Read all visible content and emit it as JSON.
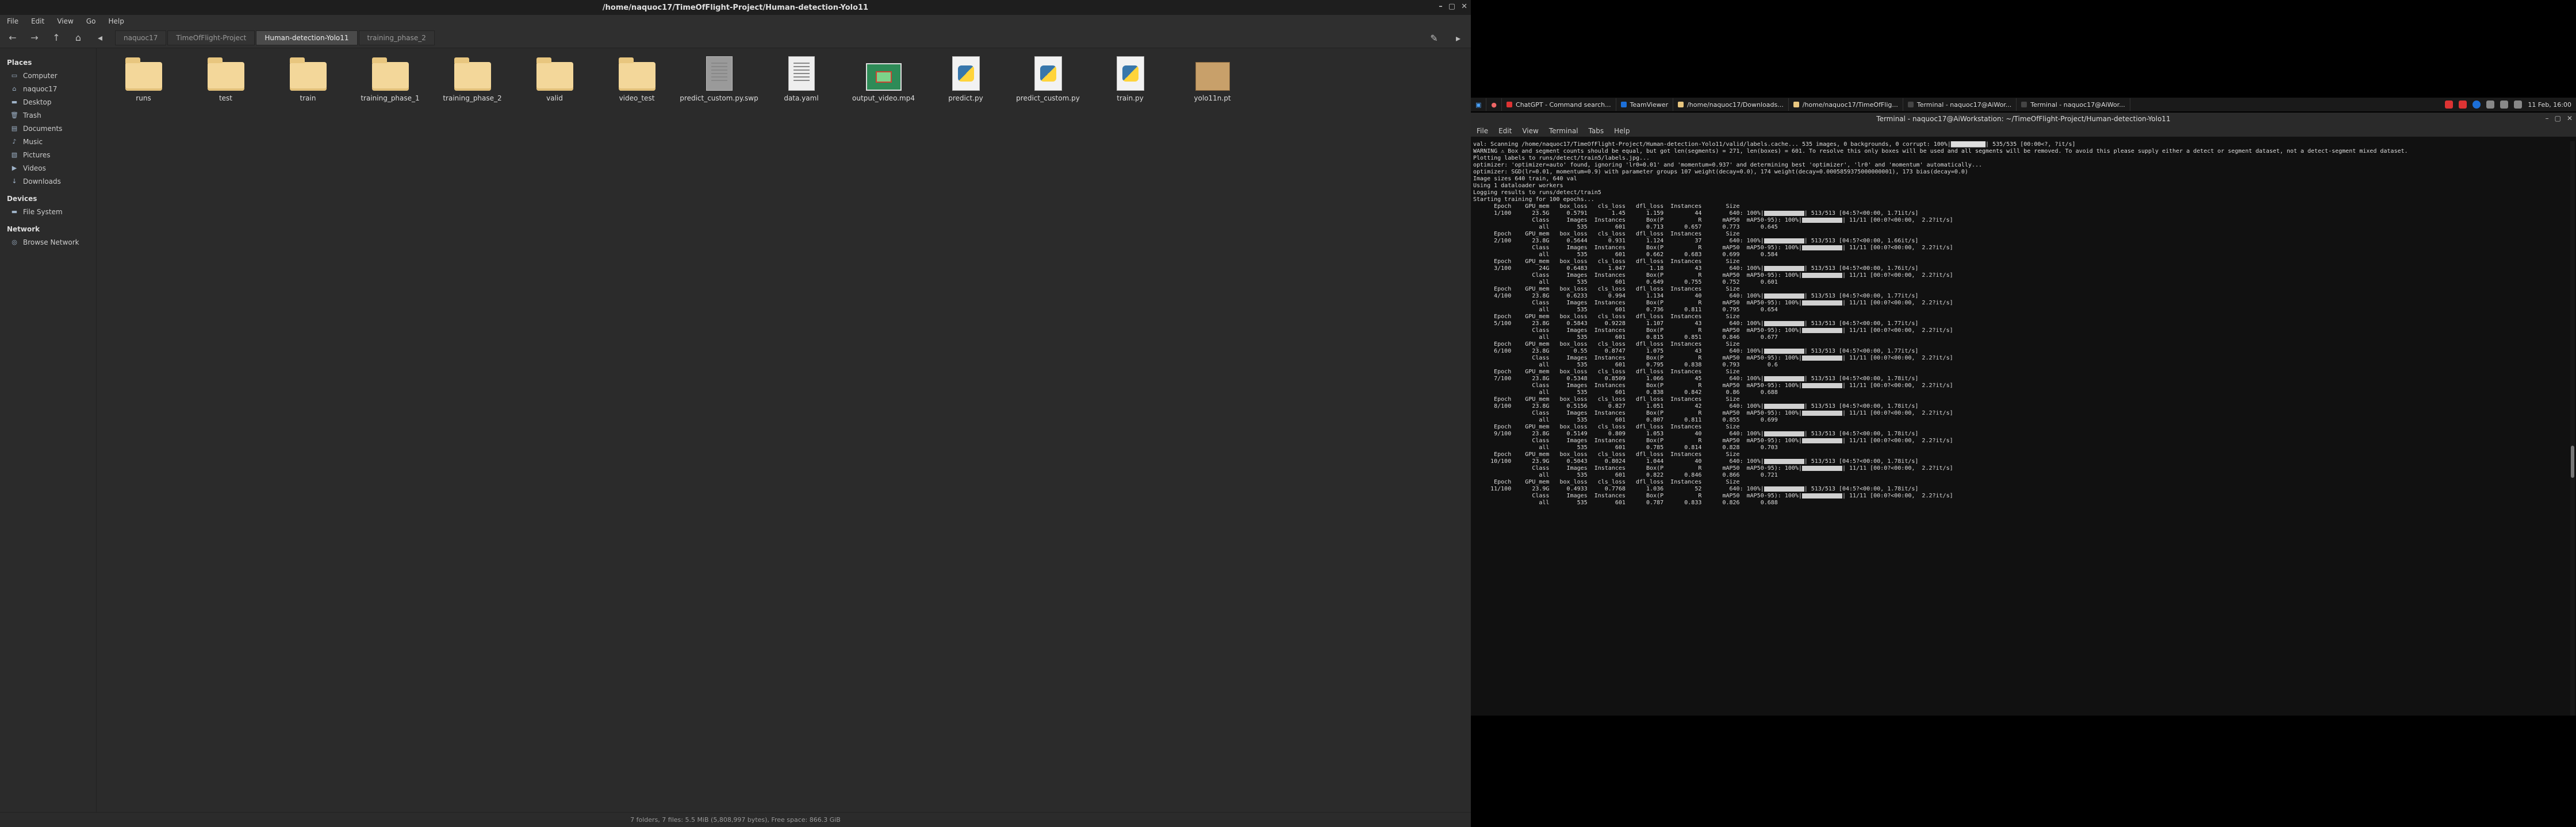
{
  "file_manager": {
    "title": "/home/naquoc17/TimeOfFlight-Project/Human-detection-Yolo11",
    "menu": [
      "File",
      "Edit",
      "View",
      "Go",
      "Help"
    ],
    "breadcrumbs": [
      "naquoc17",
      "TimeOfFlight-Project",
      "Human-detection-Yolo11",
      "training_phase_2"
    ],
    "active_crumb_index": 2,
    "sidebar": {
      "places_header": "Places",
      "places": [
        {
          "label": "Computer",
          "icon": "computer-icon"
        },
        {
          "label": "naquoc17",
          "icon": "home-icon"
        },
        {
          "label": "Desktop",
          "icon": "desktop-icon"
        },
        {
          "label": "Trash",
          "icon": "trash-icon"
        },
        {
          "label": "Documents",
          "icon": "documents-icon"
        },
        {
          "label": "Music",
          "icon": "music-icon"
        },
        {
          "label": "Pictures",
          "icon": "pictures-icon"
        },
        {
          "label": "Videos",
          "icon": "videos-icon"
        },
        {
          "label": "Downloads",
          "icon": "downloads-icon"
        }
      ],
      "devices_header": "Devices",
      "devices": [
        {
          "label": "File System",
          "icon": "drive-icon"
        }
      ],
      "network_header": "Network",
      "network": [
        {
          "label": "Browse Network",
          "icon": "network-icon"
        }
      ]
    },
    "files": [
      {
        "name": "runs",
        "kind": "folder"
      },
      {
        "name": "test",
        "kind": "folder"
      },
      {
        "name": "train",
        "kind": "folder"
      },
      {
        "name": "training_phase_1",
        "kind": "folder"
      },
      {
        "name": "training_phase_2",
        "kind": "folder"
      },
      {
        "name": "valid",
        "kind": "folder"
      },
      {
        "name": "video_test",
        "kind": "folder"
      },
      {
        "name": "predict_custom.py.swp",
        "kind": "swap"
      },
      {
        "name": "data.yaml",
        "kind": "text"
      },
      {
        "name": "output_video.mp4",
        "kind": "video"
      },
      {
        "name": "predict.py",
        "kind": "python"
      },
      {
        "name": "predict_custom.py",
        "kind": "python"
      },
      {
        "name": "train.py",
        "kind": "python"
      },
      {
        "name": "yolo11n.pt",
        "kind": "archive"
      }
    ],
    "status": "7 folders, 7 files: 5.5 MiB (5,808,997 bytes), Free space: 866.3 GiB"
  },
  "taskbar": {
    "buttons": [
      {
        "label": "ChatGPT - Command search...",
        "color": "#d33"
      },
      {
        "label": "TeamViewer",
        "color": "#1c6fd8"
      },
      {
        "label": "/home/naquoc17/Downloads...",
        "color": "#e8c67f"
      },
      {
        "label": "/home/naquoc17/TimeOfFlig...",
        "color": "#e8c67f"
      },
      {
        "label": "Terminal - naquoc17@AiWor...",
        "color": "#444"
      },
      {
        "label": "Terminal - naquoc17@AiWor...",
        "color": "#444"
      }
    ],
    "clock": "11 Feb, 16:00"
  },
  "terminal": {
    "title": "Terminal - naquoc17@AiWorkstation: ~/TimeOfFlight-Project/Human-detection-Yolo11",
    "menu": [
      "File",
      "Edit",
      "View",
      "Terminal",
      "Tabs",
      "Help"
    ],
    "preamble": [
      "val: Scanning /home/naquoc17/TimeOfFlight-Project/Human-detection-Yolo11/valid/labels.cache... 535 images, 0 backgrounds, 0 corrupt: 100%|██████████| 535/535 [00:00<?, ?it/s]",
      "WARNING ⚠ Box and segment counts should be equal, but got len(segments) = 271, len(boxes) = 601. To resolve this only boxes will be used and all segments will be removed. To avoid this please supply either a detect or segment dataset, not a detect-segment mixed dataset.",
      "Plotting labels to runs/detect/train5/labels.jpg...",
      "optimizer: 'optimizer=auto' found, ignoring 'lr0=0.01' and 'momentum=0.937' and determining best 'optimizer', 'lr0' and 'momentum' automatically...",
      "optimizer: SGD(lr=0.01, momentum=0.9) with parameter groups 107 weight(decay=0.0), 174 weight(decay=0.0005859375000000001), 173 bias(decay=0.0)",
      "Image sizes 640 train, 640 val",
      "Using 1 dataloader workers",
      "Logging results to runs/detect/train5",
      "Starting training for 100 epochs..."
    ],
    "epochs": [
      {
        "epoch": "1/100",
        "gpu": "23.5G",
        "box": "0.5791",
        "cls": "1.45",
        "dfl": "1.159",
        "inst": "44",
        "speed": "1.71it/s",
        "P": "0.713",
        "R": "0.657",
        "m50": "0.773",
        "m5095": "0.645"
      },
      {
        "epoch": "2/100",
        "gpu": "23.8G",
        "box": "0.5644",
        "cls": "0.931",
        "dfl": "1.124",
        "inst": "37",
        "speed": "1.66it/s",
        "P": "0.662",
        "R": "0.683",
        "m50": "0.699",
        "m5095": "0.584"
      },
      {
        "epoch": "3/100",
        "gpu": "24G",
        "box": "0.6483",
        "cls": "1.047",
        "dfl": "1.18",
        "inst": "43",
        "speed": "1.76it/s",
        "P": "0.649",
        "R": "0.755",
        "m50": "0.752",
        "m5095": "0.601"
      },
      {
        "epoch": "4/100",
        "gpu": "23.8G",
        "box": "0.6233",
        "cls": "0.994",
        "dfl": "1.134",
        "inst": "40",
        "speed": "1.77it/s",
        "P": "0.736",
        "R": "0.811",
        "m50": "0.795",
        "m5095": "0.654"
      },
      {
        "epoch": "5/100",
        "gpu": "23.8G",
        "box": "0.5843",
        "cls": "0.9228",
        "dfl": "1.107",
        "inst": "43",
        "speed": "1.77it/s",
        "P": "0.815",
        "R": "0.851",
        "m50": "0.846",
        "m5095": "0.677"
      },
      {
        "epoch": "6/100",
        "gpu": "23.8G",
        "box": "0.55",
        "cls": "0.8747",
        "dfl": "1.075",
        "inst": "43",
        "speed": "1.77it/s",
        "P": "0.795",
        "R": "0.838",
        "m50": "0.793",
        "m5095": "0.6"
      },
      {
        "epoch": "7/100",
        "gpu": "23.8G",
        "box": "0.5348",
        "cls": "0.8509",
        "dfl": "1.066",
        "inst": "45",
        "speed": "1.78it/s",
        "P": "0.838",
        "R": "0.842",
        "m50": "0.86",
        "m5095": "0.688"
      },
      {
        "epoch": "8/100",
        "gpu": "23.8G",
        "box": "0.5156",
        "cls": "0.827",
        "dfl": "1.051",
        "inst": "42",
        "speed": "1.78it/s",
        "P": "0.807",
        "R": "0.811",
        "m50": "0.855",
        "m5095": "0.699"
      },
      {
        "epoch": "9/100",
        "gpu": "23.8G",
        "box": "0.5149",
        "cls": "0.809",
        "dfl": "1.053",
        "inst": "40",
        "speed": "1.78it/s",
        "P": "0.785",
        "R": "0.814",
        "m50": "0.828",
        "m5095": "0.703"
      },
      {
        "epoch": "10/100",
        "gpu": "23.9G",
        "box": "0.5043",
        "cls": "0.8024",
        "dfl": "1.044",
        "inst": "40",
        "speed": "1.78it/s",
        "P": "0.822",
        "R": "0.846",
        "m50": "0.866",
        "m5095": "0.721"
      },
      {
        "epoch": "11/100",
        "gpu": "23.9G",
        "box": "0.4933",
        "cls": "0.7768",
        "dfl": "1.036",
        "inst": "52",
        "speed": "1.78it/s",
        "P": "0.787",
        "R": "0.833",
        "m50": "0.826",
        "m5095": "0.688"
      }
    ],
    "header_row": "      Epoch    GPU_mem   box_loss   cls_loss   dfl_loss  Instances       Size",
    "class_header": "                 Class     Images  Instances      Box(P          R      mAP50  mAP50-95): 100%|",
    "val_images": "535",
    "val_instances": "601",
    "batches": "513/513",
    "val_batches": "11/11"
  }
}
